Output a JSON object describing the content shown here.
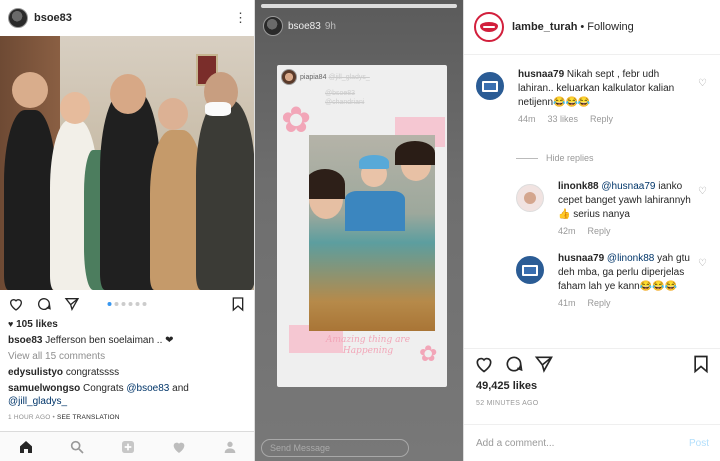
{
  "left": {
    "username": "bsoe83",
    "more_icon": "⋮",
    "likes": "105 likes",
    "caption_user": "bsoe83",
    "caption_text": "Jefferson ben soelaiman .. ❤",
    "view_comments": "View all 15 comments",
    "comments": [
      {
        "user": "edysulistyo",
        "text": "congratssss"
      },
      {
        "user": "samuelwongso",
        "text_pre": "Congrats ",
        "mention1": "@bsoe83",
        "text_mid": " and ",
        "mention2": "@jill_gladys_"
      }
    ],
    "time": "1 HOUR AGO",
    "translate": "SEE TRANSLATION",
    "carousel": {
      "count": 6,
      "active": 1
    }
  },
  "middle": {
    "username": "bsoe83",
    "time": "9h",
    "card_user": "piapia84",
    "card_tag1": "@jill_gladys_",
    "card_tag2": "@bsoe83",
    "card_tag3": "@chandriani",
    "quote": "Amazing thing are Happening",
    "send_placeholder": "Send Message"
  },
  "right": {
    "username": "lambe_turah",
    "separator": "•",
    "following": "Following",
    "comments": [
      {
        "user": "husnaa79",
        "text": "Nikah sept , febr udh lahiran.. keluarkan kalkulator kalian netijenn😂😂😂",
        "time": "44m",
        "likes": "33 likes",
        "reply": "Reply"
      },
      {
        "user": "linonk88",
        "mention": "@husnaa79",
        "text": "ianko cepet banget yawh lahirannyh👍 serius nanya",
        "time": "42m",
        "reply": "Reply"
      },
      {
        "user": "husnaa79",
        "mention": "@linonk88",
        "text": "yah gtu deh mba, ga perlu diperjelas faham lah ye kann😂😂😂",
        "time": "41m",
        "reply": "Reply"
      }
    ],
    "hide_replies": "Hide replies",
    "likes": "49,425 likes",
    "time": "52 MINUTES AGO",
    "add_comment": "Add a comment...",
    "post": "Post"
  },
  "colors": {
    "brand_red": "#d21f3c",
    "link": "#003569",
    "active_dot": "#3897f0"
  }
}
